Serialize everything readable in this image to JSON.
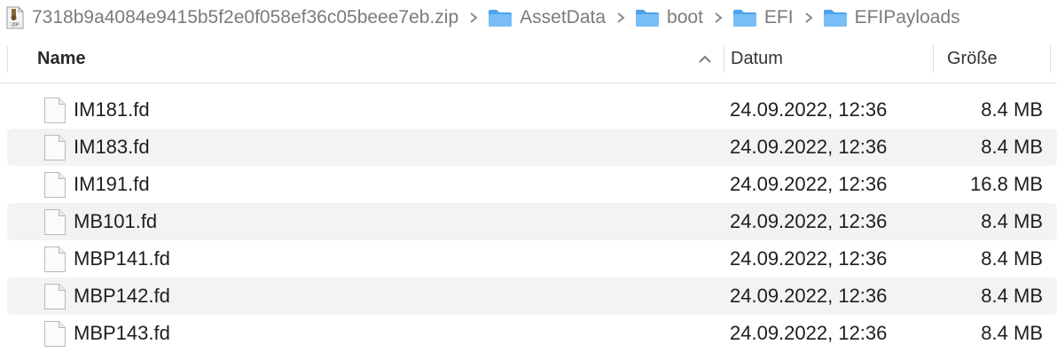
{
  "breadcrumb": [
    {
      "label": "7318b9a4084e9415b5f2e0f058ef36c05beee7eb.zip",
      "icon": "zip-archive-icon"
    },
    {
      "label": "AssetData",
      "icon": "folder-icon"
    },
    {
      "label": "boot",
      "icon": "folder-icon"
    },
    {
      "label": "EFI",
      "icon": "folder-icon"
    },
    {
      "label": "EFIPayloads",
      "icon": "folder-icon"
    }
  ],
  "columns": {
    "name": "Name",
    "date": "Datum",
    "size": "Größe",
    "sort_indicator": "chevron-up-icon"
  },
  "files": [
    {
      "name": "IM181.fd",
      "date": "24.09.2022, 12:36",
      "size": "8.4 MB"
    },
    {
      "name": "IM183.fd",
      "date": "24.09.2022, 12:36",
      "size": "8.4 MB"
    },
    {
      "name": "IM191.fd",
      "date": "24.09.2022, 12:36",
      "size": "16.8 MB"
    },
    {
      "name": "MB101.fd",
      "date": "24.09.2022, 12:36",
      "size": "8.4 MB"
    },
    {
      "name": "MBP141.fd",
      "date": "24.09.2022, 12:36",
      "size": "8.4 MB"
    },
    {
      "name": "MBP142.fd",
      "date": "24.09.2022, 12:36",
      "size": "8.4 MB"
    },
    {
      "name": "MBP143.fd",
      "date": "24.09.2022, 12:36",
      "size": "8.4 MB"
    }
  ],
  "colors": {
    "folder": "#5fb0f2",
    "row_alt": "#f3f3f3",
    "breadcrumb_text": "#7b7b7b"
  }
}
